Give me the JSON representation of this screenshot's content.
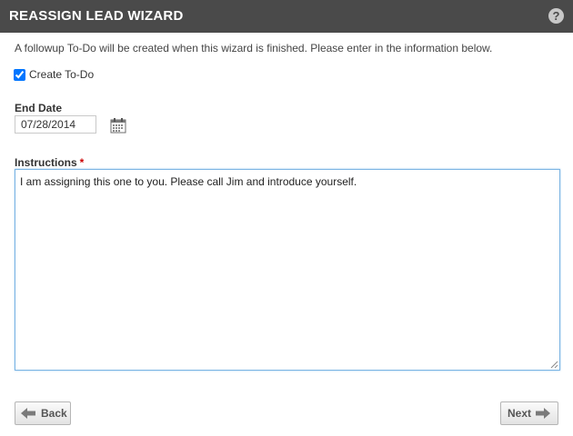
{
  "header": {
    "title": "REASSIGN LEAD WIZARD",
    "help_icon": "?"
  },
  "intro_text": "A followup To-Do will be created when this wizard is finished. Please enter in the information below.",
  "create_todo": {
    "label": "Create To-Do",
    "checked": true
  },
  "end_date": {
    "label": "End Date",
    "value": "07/28/2014"
  },
  "instructions": {
    "label": "Instructions",
    "required_marker": "*",
    "value": "I am assigning this one to you. Please call Jim and introduce yourself."
  },
  "nav": {
    "back_label": "Back",
    "next_label": "Next"
  },
  "icons": {
    "help": "help-icon",
    "calendar": "calendar-icon",
    "back": "arrow-left-icon",
    "next": "arrow-right-icon"
  },
  "colors": {
    "header_bg": "#4a4a4a",
    "required": "#cc0000",
    "focus_border": "#7bb4e3"
  }
}
